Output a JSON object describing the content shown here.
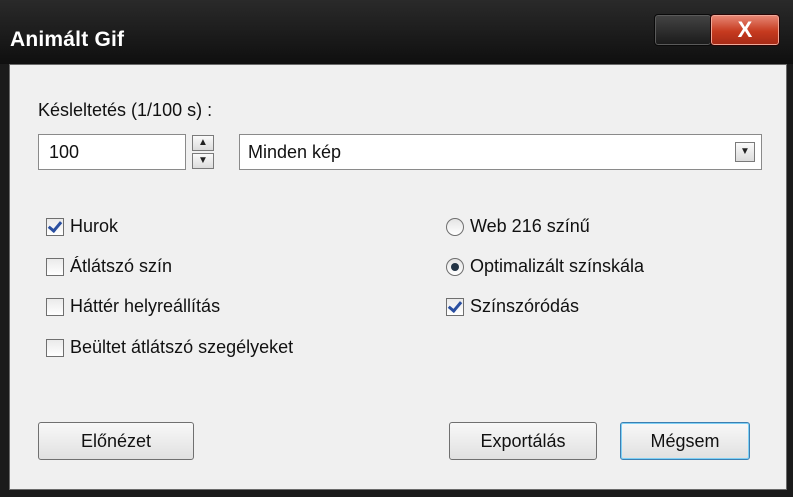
{
  "window": {
    "title": "Animált Gif",
    "close_label": "X"
  },
  "delay": {
    "label": "Késleltetés (1/100 s) :",
    "value": "100"
  },
  "frames_select": {
    "selected": "Minden kép"
  },
  "options_left": [
    {
      "label": "Hurok",
      "checked": true
    },
    {
      "label": "Átlátszó szín",
      "checked": false
    },
    {
      "label": "Háttér helyreállítás",
      "checked": false
    },
    {
      "label": "Beültet átlátszó szegélyeket",
      "checked": false
    }
  ],
  "palette": [
    {
      "label": "Web 216 színű",
      "selected": false
    },
    {
      "label": "Optimalizált színskála",
      "selected": true
    }
  ],
  "dither": {
    "label": "Színszóródás",
    "checked": true
  },
  "buttons": {
    "preview": "Előnézet",
    "export": "Exportálás",
    "cancel": "Mégsem"
  },
  "colors": {
    "titlebar": "#1b1b1b",
    "client": "#f0f0f0",
    "close_button": "#c63a1f",
    "checkmark": "#2a4fa0"
  }
}
